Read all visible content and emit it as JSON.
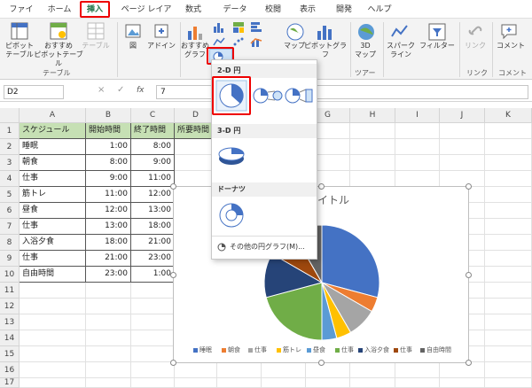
{
  "ribbon_tabs": [
    "ファイル",
    "ホーム",
    "挿入",
    "ページ レイアウト",
    "数式",
    "データ",
    "校閲",
    "表示",
    "開発",
    "ヘルプ"
  ],
  "active_tab": "挿入",
  "ribbon": {
    "pivot": "ピボット\nテーブル",
    "recommended_pivot": "おすすめ\nピボットテーブル",
    "table": "テーブル",
    "group_table": "テーブル",
    "illustrations": "図",
    "addins": "アドイン",
    "recommended_chart": "おすすめ\nグラフ",
    "map": "マップ",
    "pivot_chart": "ピボットグラフ",
    "map3d": "3D\nマップ",
    "group_tour": "ツアー",
    "sparkline": "スパーク\nライン",
    "filter": "フィルター",
    "link": "リンク",
    "group_link": "リンク",
    "comment": "コメント",
    "group_comment": "コメント"
  },
  "formula_bar": {
    "name_box": "D2",
    "cancel": "×",
    "enter": "✓",
    "fx": "fx",
    "content": "7"
  },
  "columns": [
    "A",
    "B",
    "C",
    "D",
    "E",
    "F",
    "G",
    "H",
    "I",
    "J",
    "K"
  ],
  "rows": [
    "1",
    "2",
    "3",
    "4",
    "5",
    "6",
    "7",
    "8",
    "9",
    "10",
    "11",
    "12",
    "13",
    "14",
    "15",
    "16",
    "17"
  ],
  "table": {
    "headers": [
      "スケジュール",
      "開始時間",
      "終了時間",
      "所要時間"
    ],
    "rows": [
      [
        "睡眠",
        "1:00",
        "8:00"
      ],
      [
        "朝食",
        "8:00",
        "9:00"
      ],
      [
        "仕事",
        "9:00",
        "11:00"
      ],
      [
        "筋トレ",
        "11:00",
        "12:00"
      ],
      [
        "昼食",
        "12:00",
        "13:00"
      ],
      [
        "仕事",
        "13:00",
        "18:00"
      ],
      [
        "入浴夕食",
        "18:00",
        "21:00"
      ],
      [
        "仕事",
        "21:00",
        "23:00"
      ],
      [
        "自由時間",
        "23:00",
        "1:00"
      ]
    ]
  },
  "dropdown": {
    "section_2d": "2-D 円",
    "section_3d": "3-D 円",
    "section_donut": "ドーナツ",
    "more": "その他の円グラフ(M)..."
  },
  "chart": {
    "title": "タイトル",
    "colors": [
      "#4472c4",
      "#ed7d31",
      "#a5a5a5",
      "#ffc000",
      "#5b9bd5",
      "#70ad47",
      "#264478",
      "#9e480e",
      "#636363"
    ],
    "legend": [
      "睡眠",
      "朝食",
      "仕事",
      "筋トレ",
      "昼食",
      "仕事",
      "入浴夕食",
      "仕事",
      "自由時間"
    ]
  },
  "chart_data": {
    "type": "pie",
    "title": "タイトル",
    "categories": [
      "睡眠",
      "朝食",
      "仕事",
      "筋トレ",
      "昼食",
      "仕事",
      "入浴夕食",
      "仕事",
      "自由時間"
    ],
    "values": [
      7,
      1,
      2,
      1,
      1,
      5,
      3,
      2,
      2
    ]
  }
}
